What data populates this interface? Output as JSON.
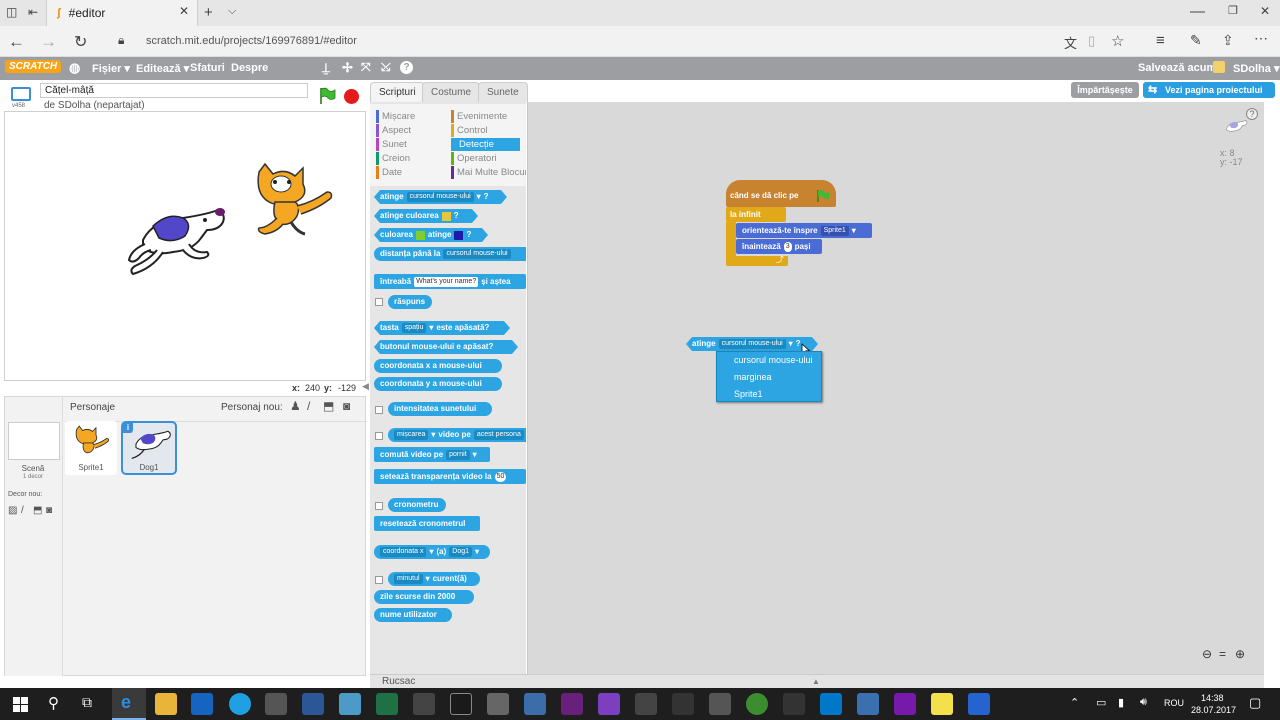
{
  "browser": {
    "tab_title": "#editor",
    "url": "scratch.mit.edu/projects/169976891/#editor"
  },
  "menubar": {
    "logo": "SCRATCH",
    "items": [
      "Fișier ▾",
      "Editează ▾",
      "Sfaturi",
      "Despre"
    ],
    "save": "Salvează acum",
    "user": "SDolha ▾"
  },
  "project": {
    "title": "Cățel-mâță",
    "author": "de SDolha (nepartajat)",
    "version": "v458",
    "share_btn": "Împărtășește",
    "view_btn": "Vezi pagina proiectului"
  },
  "stage_coords": {
    "x_label": "x:",
    "x": "240",
    "y_label": "y:",
    "y": "-129"
  },
  "sprites": {
    "header": "Personaje",
    "new_label": "Personaj nou:",
    "stage_label": "Scenă",
    "stage_sub": "1 decor",
    "backdrop_label": "Decor nou:",
    "list": [
      "Sprite1",
      "Dog1"
    ]
  },
  "tabs": [
    "Scripturi",
    "Costume",
    "Sunete"
  ],
  "categories": {
    "left": [
      "Mișcare",
      "Aspect",
      "Sunet",
      "Creion",
      "Date"
    ],
    "right": [
      "Evenimente",
      "Control",
      "Detecție",
      "Operatori",
      "Mai Multe Blocuri"
    ],
    "colors": {
      "Mișcare": "#4a6cd4",
      "Aspect": "#8a55d7",
      "Sunet": "#bb42c3",
      "Creion": "#0e9a6c",
      "Date": "#ee7d16",
      "Evenimente": "#c88330",
      "Control": "#e1a91a",
      "Detecție": "#2ca5e2",
      "Operatori": "#5cb712",
      "Mai Multe Blocuri": "#632d99"
    }
  },
  "palette_blocks": {
    "b1": "atinge",
    "b1_dd": "cursorul mouse-ului",
    "q": "?",
    "b2": "atinge culoarea",
    "b3a": "culoarea",
    "b3b": "atinge",
    "b4": "distanța până la",
    "b4_dd": "cursorul mouse-ului",
    "b5": "întreabă",
    "b5_inp": "What's your name?",
    "b5b": "și aștea",
    "b6": "răspuns",
    "b7": "tasta",
    "b7_dd": "spațiu",
    "b7b": "este apăsată?",
    "b8": "butonul mouse-ului e apăsat?",
    "b9": "coordonata x a mouse-ului",
    "b10": "coordonata y a mouse-ului",
    "b11": "intensitatea sunetului",
    "b12_dd": "mișcarea",
    "b12": "video pe",
    "b12_dd2": "acest persona",
    "b13": "comută video pe",
    "b13_dd": "pornit",
    "b14": "setează transparența video la",
    "b14_inp": "50",
    "b15": "cronometru",
    "b16": "resetează cronometrul",
    "b17_dd": "coordonata x",
    "b17": "(a)",
    "b17_dd2": "Dog1",
    "b18_dd": "minutul",
    "b18": "curent(ă)",
    "b19": "zile scurse din 2000",
    "b20": "nume utilizator"
  },
  "script": {
    "hat": "când se dă clic pe",
    "loop": "la infinit",
    "point": "orientează-te înspre",
    "point_dd": "Sprite1",
    "move": "înaintează",
    "move_val": "3",
    "move_unit": "pași"
  },
  "floating_block": {
    "label": "atinge",
    "dd": "cursorul mouse-ului",
    "q": "?"
  },
  "dropdown_options": [
    "cursorul mouse-ului",
    "marginea",
    "Sprite1"
  ],
  "sprite_info": {
    "x": "x: 8",
    "y": "y: -17"
  },
  "rucsac": "Rucsac",
  "taskbar": {
    "lang": "ROU",
    "time": "14:38",
    "date": "28.07.2017"
  }
}
